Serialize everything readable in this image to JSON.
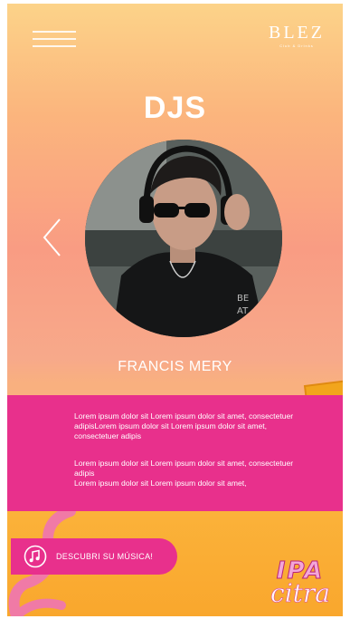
{
  "header": {
    "logo_main": "BLEZ",
    "logo_sub": "Club & Drinks"
  },
  "page_title": "DJS",
  "dj": {
    "name": "FRANCIS MERY"
  },
  "description": {
    "paragraph1": "Lorem ipsum dolor sit Lorem ipsum dolor sit amet, consectetuer adipisLorem ipsum dolor sit Lorem ipsum dolor sit amet, consectetuer adipis",
    "paragraph2_line1": "Lorem ipsum dolor sit Lorem ipsum dolor sit amet, consectetuer adipis",
    "paragraph2_line2": "Lorem ipsum dolor sit Lorem ipsum dolor sit amet,"
  },
  "cta": {
    "label": "DESCUBRI SU MÚSICA!"
  },
  "brand": {
    "line1": "IPA",
    "line2": "citra"
  },
  "colors": {
    "accent_pink": "#e8308c",
    "gradient_top": "#fcd389",
    "gradient_mid": "#f99c83",
    "bottom_orange": "#fbb23a"
  }
}
